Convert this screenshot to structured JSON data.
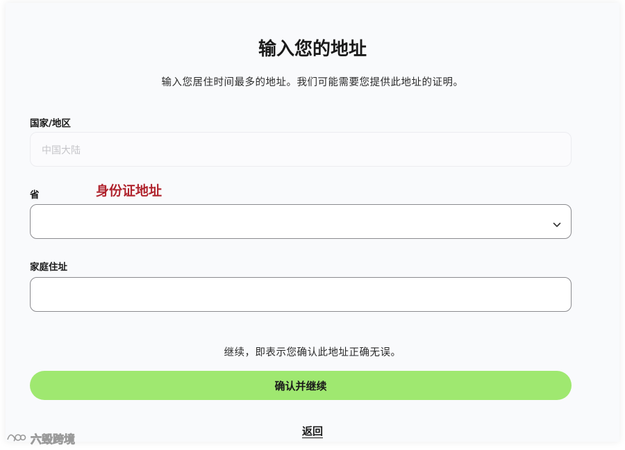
{
  "page": {
    "title": "输入您的地址",
    "subtitle": "输入您居住时间最多的地址。我们可能需要您提供此地址的证明。"
  },
  "form": {
    "country": {
      "label": "国家/地区",
      "value": "中国大陆"
    },
    "province": {
      "label": "省",
      "value": ""
    },
    "home_address": {
      "label": "家庭住址",
      "value": ""
    }
  },
  "annotation": {
    "text": "身份证地址",
    "color": "#b0242e"
  },
  "confirm_note": "继续，即表示您确认此地址正确无误。",
  "buttons": {
    "confirm_continue": "确认并继续",
    "back": "返回"
  },
  "watermark": {
    "text": "六毁跨境"
  },
  "colors": {
    "accent": "#9fe870",
    "annotation": "#b0242e",
    "border": "#8a8a8e"
  },
  "icons": {
    "dropdown": "chevron-down-icon",
    "watermark_logo": "watermark-logo-icon"
  }
}
